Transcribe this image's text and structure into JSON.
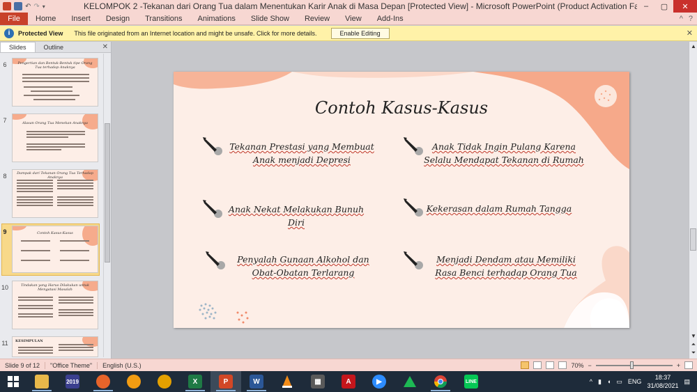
{
  "window": {
    "title": "KELOMPOK 2 -Tekanan dari Orang Tua dalam Menentukan Karir Anak di Masa Depan [Protected View]  -  Microsoft PowerPoint (Product Activation Failed)",
    "controls": {
      "minimize": "–",
      "maximize": "▢",
      "close": "✕"
    }
  },
  "ribbon": {
    "file_label": "File",
    "tabs": [
      "Home",
      "Insert",
      "Design",
      "Transitions",
      "Animations",
      "Slide Show",
      "Review",
      "View",
      "Add-Ins"
    ],
    "right_icons": [
      "^",
      "?"
    ]
  },
  "protected_view": {
    "icon": "i",
    "title": "Protected View",
    "message": "This file originated from an Internet location and might be unsafe. Click for more details.",
    "button": "Enable Editing",
    "close": "✕"
  },
  "slides_panel": {
    "tabs": [
      "Slides",
      "Outline"
    ],
    "close": "✕",
    "thumbnails": [
      {
        "num": "6",
        "title": "Pengertian dan Bentuk-Bentuk tipe Orang Tua terhadap Anaknya"
      },
      {
        "num": "7",
        "title": "Alasan Orang Tua Menekan Anaknya"
      },
      {
        "num": "8",
        "title": "Dampak dari Tekanan Orang Tua Terhadap Anaknya"
      },
      {
        "num": "9",
        "title": "Contoh Kasus-Kasus"
      },
      {
        "num": "10",
        "title": "Tindakan yang Harus Dilakukan untuk Mengatasi Masalah"
      },
      {
        "num": "11",
        "title": "KESIMPULAN"
      }
    ]
  },
  "slide": {
    "title": "Contoh Kasus-Kasus",
    "items": [
      "Tekanan Prestasi yang Membuat Anak menjadi Depresi",
      "Anak Tidak Ingin Pulang Karena Selalu Mendapat Tekanan di Rumah",
      "Anak Nekat Melakukan Bunuh Diri",
      "Kekerasan dalam Rumah Tangga",
      "Penyalah Gunaan Alkohol dan Obat-Obatan Terlarang",
      "Menjadi Dendam atau Memiliki Rasa Benci terhadap Orang Tua"
    ]
  },
  "status": {
    "slide_info": "Slide 9 of 12",
    "theme": "\"Office Theme\"",
    "language": "English (U.S.)",
    "zoom": "70%",
    "zoom_minus": "−",
    "zoom_plus": "+"
  },
  "taskbar": {
    "apps": [
      "file-explorer",
      "calendar-2019",
      "firefox",
      "orange-app",
      "headphones-app",
      "excel",
      "powerpoint",
      "word",
      "vlc",
      "video-editor",
      "acrobat",
      "zoom",
      "green-triangle-app",
      "chrome",
      "line"
    ],
    "calendar_label": "2019",
    "line_label": "LINE",
    "language": "ENG",
    "time": "18:37",
    "date": "31/08/2021"
  },
  "colors": {
    "titlebar": "#f7d7d2",
    "file_tab": "#c8412a",
    "slide_bg": "#fdeee7",
    "slide_accent": "#f6a98a",
    "protected_bar": "#fff2a8"
  }
}
